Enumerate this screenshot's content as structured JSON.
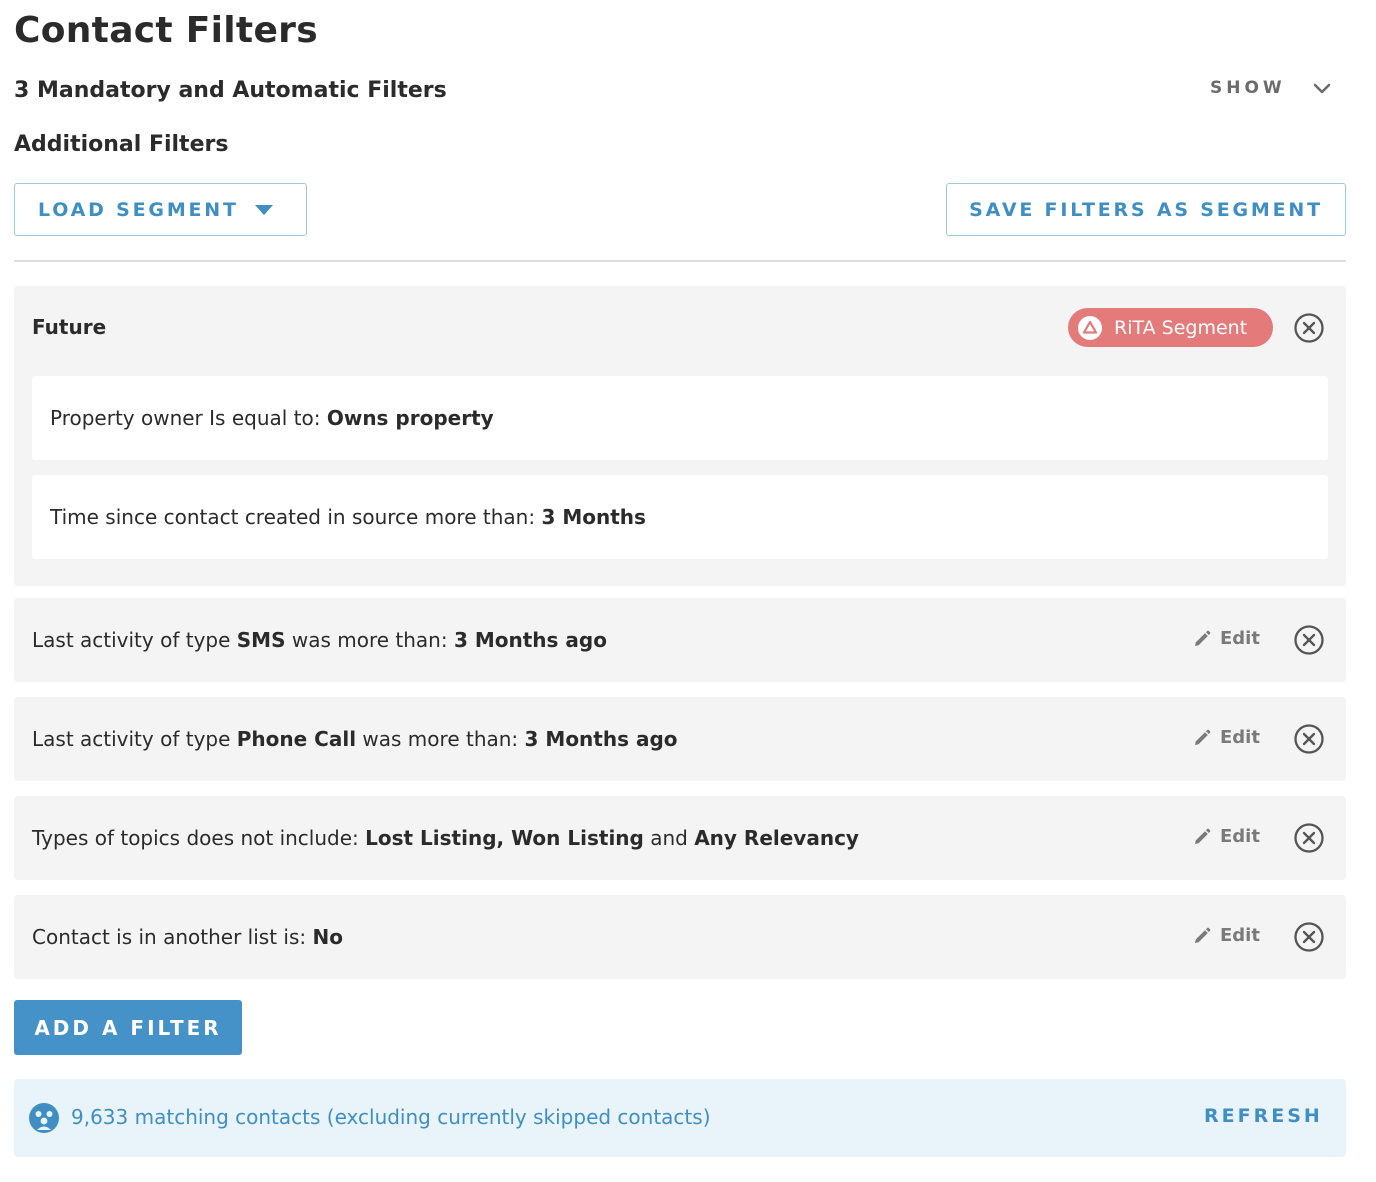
{
  "page": {
    "title": "Contact Filters"
  },
  "mandatory": {
    "label": "3 Mandatory and Automatic Filters",
    "toggle_label": "SHOW"
  },
  "additional": {
    "heading": "Additional Filters"
  },
  "toolbar": {
    "load_segment_label": "LOAD SEGMENT",
    "save_segment_label": "SAVE FILTERS AS SEGMENT"
  },
  "segment_group": {
    "name": "Future",
    "badge": "RiTA Segment",
    "badge_color": "#e57a7a",
    "conditions": [
      {
        "prefix": "Property owner Is equal to: ",
        "value": "Owns property"
      },
      {
        "prefix": "Time since contact created in source more than: ",
        "value": "3 Months"
      }
    ]
  },
  "filters": [
    {
      "p1": "Last activity of type ",
      "b1": "SMS",
      "p2": " was more than: ",
      "b2": "3 Months ago",
      "edit": "Edit"
    },
    {
      "p1": "Last activity of type ",
      "b1": "Phone Call",
      "p2": " was more than: ",
      "b2": "3 Months ago",
      "edit": "Edit"
    },
    {
      "p1": "Types of topics does not include: ",
      "b1": "Lost Listing, Won Listing",
      "p2": " and ",
      "b2": "Any Relevancy",
      "edit": "Edit"
    },
    {
      "p1": "Contact is in another list is: ",
      "b1": "No",
      "p2": "",
      "b2": "",
      "edit": "Edit"
    }
  ],
  "add_filter_label": "ADD A FILTER",
  "match": {
    "text": "9,633 matching contacts (excluding currently skipped contacts)",
    "refresh_label": "REFRESH"
  },
  "colors": {
    "accent": "#3f8fc4",
    "primary_button": "#4592c9",
    "badge": "#e57a7a",
    "card_bg": "#f4f4f4",
    "info_bg": "#e9f3fa"
  }
}
